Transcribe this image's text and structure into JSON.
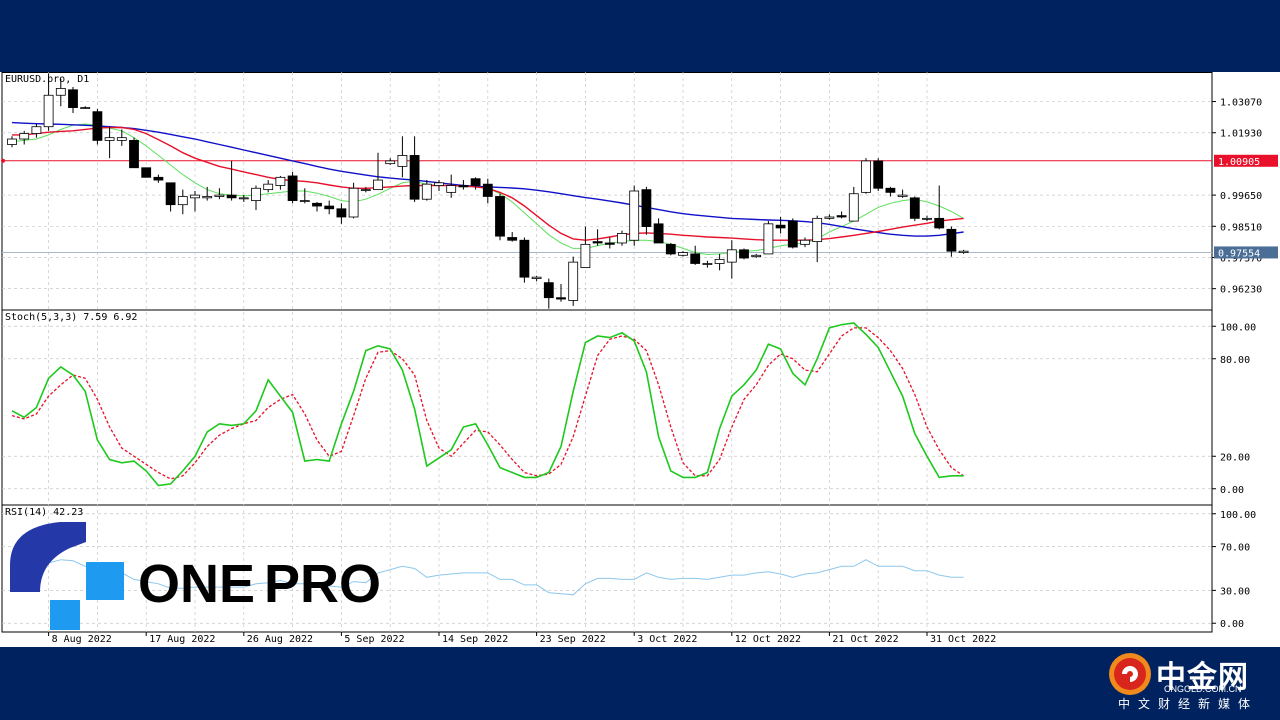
{
  "chart_data": {
    "type": "candlestick",
    "symbol_label": "EURUSD.pro, D1",
    "price_ticks": [
      "1.03070",
      "1.01930",
      "0.99650",
      "0.98510",
      "0.97370",
      "0.96230"
    ],
    "price_range": [
      0.9545,
      1.0415
    ],
    "markers": {
      "red_line_label": "1.00905",
      "red_line_value": 1.00905,
      "current_label": "0.97554",
      "current_value": 0.97554,
      "red_color": "#e8102a",
      "current_color": "#4a6e96"
    },
    "x_labels": [
      {
        "i": 3,
        "text": "8 Aug 2022"
      },
      {
        "i": 11,
        "text": "17 Aug 2022"
      },
      {
        "i": 19,
        "text": "26 Aug 2022"
      },
      {
        "i": 27,
        "text": "5 Sep 2022"
      },
      {
        "i": 35,
        "text": "14 Sep 2022"
      },
      {
        "i": 43,
        "text": "23 Sep 2022"
      },
      {
        "i": 51,
        "text": "3 Oct 2022"
      },
      {
        "i": 59,
        "text": "12 Oct 2022"
      },
      {
        "i": 67,
        "text": "21 Oct 2022"
      },
      {
        "i": 75,
        "text": "31 Oct 2022"
      }
    ],
    "candles": [
      [
        1.015,
        1.018,
        1.014,
        1.017
      ],
      [
        1.017,
        1.02,
        1.015,
        1.019
      ],
      [
        1.019,
        1.0225,
        1.0175,
        1.0215
      ],
      [
        1.0215,
        1.041,
        1.02,
        1.033
      ],
      [
        1.033,
        1.039,
        1.029,
        1.0355
      ],
      [
        1.035,
        1.036,
        1.0265,
        1.0285
      ],
      [
        1.0285,
        1.029,
        1.028,
        1.0285
      ],
      [
        1.027,
        1.028,
        1.015,
        1.0165
      ],
      [
        1.0165,
        1.0215,
        1.01,
        1.0175
      ],
      [
        1.0165,
        1.0205,
        1.0145,
        1.0175
      ],
      [
        1.0165,
        1.0175,
        1.0065,
        1.0065
      ],
      [
        1.0065,
        1.0065,
        1.003,
        1.003
      ],
      [
        1.003,
        1.004,
        1.001,
        1.002
      ],
      [
        1.001,
        1.001,
        0.9905,
        0.993
      ],
      [
        0.993,
        0.9985,
        0.9895,
        0.996
      ],
      [
        0.9955,
        0.998,
        0.9905,
        0.9965
      ],
      [
        0.9955,
        0.9995,
        0.9945,
        0.996
      ],
      [
        0.996,
        0.999,
        0.995,
        0.9965
      ],
      [
        0.9965,
        1.009,
        0.9945,
        0.9955
      ],
      [
        0.9955,
        0.9965,
        0.994,
        0.9955
      ],
      [
        0.9945,
        1.0,
        0.991,
        0.999
      ],
      [
        0.9985,
        1.002,
        0.9975,
        1.0005
      ],
      [
        1.0,
        1.0035,
        0.9985,
        1.003
      ],
      [
        1.0035,
        1.005,
        0.9935,
        0.9945
      ],
      [
        0.9945,
        0.999,
        0.9935,
        0.9945
      ],
      [
        0.9935,
        0.994,
        0.9905,
        0.9925
      ],
      [
        0.9925,
        0.9945,
        0.9895,
        0.9915
      ],
      [
        0.9915,
        0.9935,
        0.986,
        0.9885
      ],
      [
        0.9885,
        1.001,
        0.988,
        0.999
      ],
      [
        0.9985,
        0.9995,
        0.9975,
        0.9985
      ],
      [
        0.9985,
        1.012,
        0.9985,
        1.002
      ],
      [
        1.008,
        1.01,
        1.0075,
        1.009
      ],
      [
        1.007,
        1.018,
        1.003,
        1.011
      ],
      [
        1.011,
        1.018,
        0.994,
        0.995
      ],
      [
        0.995,
        1.002,
        0.9945,
        1.0005
      ],
      [
        1.0,
        1.002,
        0.998,
        1.001
      ],
      [
        0.9975,
        1.004,
        0.9955,
        1.0
      ],
      [
        1.0,
        1.002,
        0.9985,
        0.9995
      ],
      [
        1.0025,
        1.003,
        0.9985,
        1.0
      ],
      [
        1.0005,
        1.0025,
        0.9935,
        0.996
      ],
      [
        0.996,
        0.997,
        0.98,
        0.9815
      ],
      [
        0.981,
        0.983,
        0.9795,
        0.98
      ],
      [
        0.98,
        0.981,
        0.9645,
        0.9665
      ],
      [
        0.966,
        0.967,
        0.965,
        0.9665
      ],
      [
        0.9645,
        0.966,
        0.955,
        0.959
      ],
      [
        0.959,
        0.964,
        0.9575,
        0.9585
      ],
      [
        0.958,
        0.974,
        0.956,
        0.972
      ],
      [
        0.97,
        0.985,
        0.97,
        0.9785
      ],
      [
        0.9795,
        0.984,
        0.978,
        0.979
      ],
      [
        0.979,
        0.981,
        0.977,
        0.9785
      ],
      [
        0.979,
        0.9835,
        0.978,
        0.9825
      ],
      [
        0.98,
        1.0,
        0.978,
        0.998
      ],
      [
        0.9985,
        0.9995,
        0.982,
        0.985
      ],
      [
        0.986,
        0.988,
        0.979,
        0.979
      ],
      [
        0.9785,
        0.979,
        0.9745,
        0.975
      ],
      [
        0.9745,
        0.976,
        0.974,
        0.9755
      ],
      [
        0.975,
        0.978,
        0.971,
        0.9715
      ],
      [
        0.9715,
        0.9725,
        0.97,
        0.9715
      ],
      [
        0.9715,
        0.975,
        0.969,
        0.973
      ],
      [
        0.972,
        0.98,
        0.966,
        0.9765
      ],
      [
        0.9765,
        0.977,
        0.973,
        0.9735
      ],
      [
        0.974,
        0.975,
        0.9735,
        0.9745
      ],
      [
        0.975,
        0.987,
        0.975,
        0.986
      ],
      [
        0.9855,
        0.9885,
        0.9825,
        0.9845
      ],
      [
        0.987,
        0.988,
        0.977,
        0.9775
      ],
      [
        0.9785,
        0.981,
        0.9775,
        0.98
      ],
      [
        0.9795,
        0.989,
        0.972,
        0.988
      ],
      [
        0.988,
        0.9895,
        0.9875,
        0.9885
      ],
      [
        0.989,
        0.9905,
        0.988,
        0.9885
      ],
      [
        0.987,
        0.9995,
        0.987,
        0.997
      ],
      [
        0.9975,
        1.01,
        0.997,
        1.009
      ],
      [
        1.009,
        1.01,
        0.998,
        0.999
      ],
      [
        0.999,
        0.9995,
        0.996,
        0.9975
      ],
      [
        0.996,
        0.9985,
        0.9955,
        0.9965
      ],
      [
        0.9955,
        0.996,
        0.987,
        0.988
      ],
      [
        0.988,
        0.989,
        0.987,
        0.988
      ],
      [
        0.988,
        1.0,
        0.984,
        0.9845
      ],
      [
        0.984,
        0.985,
        0.974,
        0.976
      ],
      [
        0.9755,
        0.9765,
        0.975,
        0.976
      ]
    ],
    "ma_fast": [
      1.016,
      1.0165,
      1.017,
      1.0185,
      1.0205,
      1.022,
      1.0225,
      1.022,
      1.021,
      1.02,
      1.0175,
      1.0145,
      1.011,
      1.0075,
      1.004,
      1.001,
      0.9985,
      0.997,
      0.9965,
      0.9962,
      0.9965,
      0.997,
      0.9975,
      0.998,
      0.998,
      0.9972,
      0.996,
      0.9945,
      0.994,
      0.995,
      0.9968,
      0.999,
      1.001,
      1.0015,
      1.0005,
      1.0,
      1.0,
      0.9998,
      0.9996,
      0.999,
      0.997,
      0.994,
      0.99,
      0.986,
      0.982,
      0.979,
      0.977,
      0.977,
      0.978,
      0.979,
      0.9795,
      0.98,
      0.98,
      0.9795,
      0.9785,
      0.977,
      0.9755,
      0.9748,
      0.975,
      0.9755,
      0.976,
      0.9762,
      0.977,
      0.978,
      0.9785,
      0.979,
      0.9805,
      0.983,
      0.985,
      0.987,
      0.9895,
      0.992,
      0.9935,
      0.9945,
      0.995,
      0.994,
      0.9925,
      0.9905,
      0.988
    ],
    "ma_mid": [
      1.0185,
      1.0185,
      1.019,
      1.0195,
      1.0198,
      1.02,
      1.0205,
      1.021,
      1.0212,
      1.0212,
      1.0205,
      1.019,
      1.0168,
      1.0145,
      1.012,
      1.01,
      1.0085,
      1.007,
      1.006,
      1.005,
      1.004,
      1.003,
      1.0022,
      1.0018,
      1.0015,
      1.001,
      1.0002,
      0.9995,
      0.999,
      0.999,
      0.9992,
      0.9995,
      0.9998,
      1.0,
      1.0,
      1.0,
      1.0,
      0.9998,
      0.9995,
      0.999,
      0.9975,
      0.9955,
      0.9925,
      0.989,
      0.9855,
      0.9825,
      0.9805,
      0.98,
      0.9805,
      0.9812,
      0.982,
      0.9825,
      0.9827,
      0.9825,
      0.9822,
      0.9818,
      0.9815,
      0.9812,
      0.981,
      0.9808,
      0.9805,
      0.9802,
      0.98,
      0.98,
      0.98,
      0.98,
      0.9802,
      0.9806,
      0.9812,
      0.9818,
      0.9825,
      0.9832,
      0.984,
      0.9848,
      0.9855,
      0.9862,
      0.987,
      0.9875,
      0.988
    ],
    "ma_slow": [
      1.023,
      1.0228,
      1.0226,
      1.0225,
      1.0224,
      1.0222,
      1.022,
      1.0218,
      1.0215,
      1.0212,
      1.0208,
      1.0202,
      1.0195,
      1.0187,
      1.0178,
      1.017,
      1.016,
      1.015,
      1.014,
      1.013,
      1.012,
      1.011,
      1.01,
      1.009,
      1.008,
      1.007,
      1.006,
      1.0052,
      1.0045,
      1.0038,
      1.0032,
      1.0027,
      1.0023,
      1.002,
      1.0015,
      1.001,
      1.0005,
      1.0,
      0.9997,
      0.9995,
      0.9993,
      0.9991,
      0.9988,
      0.9983,
      0.9977,
      0.997,
      0.9963,
      0.9956,
      0.995,
      0.9943,
      0.9936,
      0.9928,
      0.992,
      0.9912,
      0.9904,
      0.9897,
      0.9892,
      0.9888,
      0.9884,
      0.988,
      0.9878,
      0.9876,
      0.9874,
      0.9873,
      0.9871,
      0.9868,
      0.9864,
      0.9858,
      0.985,
      0.9842,
      0.9835,
      0.9828,
      0.9822,
      0.9818,
      0.9815,
      0.9815,
      0.9818,
      0.9824,
      0.983
    ],
    "ma_colors": {
      "fast": "#5de05d",
      "mid": "#e8102a",
      "slow": "#1010c8"
    },
    "stoch": {
      "label": "Stoch(5,3,3) 7.59 6.92",
      "ticks": [
        "100.00",
        "80.00",
        "20.00",
        "0.00"
      ],
      "tick_values": [
        100,
        80,
        20,
        0
      ],
      "k": [
        48,
        44,
        50,
        68,
        75,
        70,
        60,
        30,
        18,
        16,
        17,
        11,
        2,
        3,
        11,
        20,
        35,
        40,
        39,
        40,
        48,
        67,
        57,
        47,
        17,
        18,
        17,
        40,
        60,
        85,
        88,
        86,
        73,
        49,
        14,
        19,
        24,
        38,
        40,
        27,
        13,
        10,
        7,
        7,
        10,
        26,
        60,
        90,
        94,
        93,
        96,
        91,
        72,
        32,
        11,
        7,
        7,
        10,
        37,
        57,
        64,
        73,
        89,
        86,
        71,
        64,
        80,
        99,
        101,
        102,
        95,
        87,
        72,
        57,
        34,
        20,
        7,
        8,
        8
      ],
      "d": [
        45,
        43,
        46,
        57,
        64,
        70,
        68,
        55,
        38,
        25,
        20,
        15,
        10,
        6,
        8,
        16,
        26,
        33,
        37,
        40,
        42,
        50,
        55,
        58,
        46,
        30,
        20,
        23,
        45,
        68,
        84,
        85,
        80,
        70,
        42,
        25,
        20,
        28,
        36,
        35,
        27,
        18,
        10,
        8,
        9,
        15,
        32,
        57,
        82,
        92,
        94,
        92,
        85,
        64,
        38,
        16,
        8,
        8,
        18,
        38,
        55,
        64,
        76,
        83,
        80,
        73,
        72,
        83,
        94,
        99,
        99,
        93,
        85,
        74,
        58,
        38,
        24,
        13,
        8
      ],
      "range": [
        -10,
        110
      ]
    },
    "rsi": {
      "label": "RSI(14) 42.23",
      "ticks": [
        "100.00",
        "70.00",
        "30.00",
        "0.00"
      ],
      "tick_values": [
        100,
        70,
        30,
        0
      ],
      "values": [
        50,
        52,
        52,
        55,
        58,
        57,
        52,
        46,
        46,
        46,
        40,
        38,
        36,
        32,
        32,
        33,
        33,
        33,
        33,
        33,
        36,
        37,
        39,
        36,
        36,
        35,
        34,
        33,
        38,
        37,
        46,
        49,
        52,
        50,
        42,
        44,
        45,
        46,
        46,
        46,
        40,
        40,
        35,
        35,
        28,
        27,
        26,
        36,
        41,
        41,
        40,
        40,
        46,
        42,
        40,
        41,
        41,
        40,
        42,
        44,
        44,
        46,
        47,
        45,
        42,
        45,
        46,
        49,
        52,
        52,
        58,
        52,
        52,
        52,
        48,
        48,
        44,
        42,
        42
      ],
      "color": "#8ec7ec",
      "range": [
        -8,
        108
      ]
    },
    "colors": {
      "k_line": "#1ec81e",
      "d_line": "#e8102a",
      "grid": "#c8c8c8"
    }
  },
  "logos": {
    "onepro": {
      "one": "ONE",
      "pro": "PRO",
      "one_color": "#3a3a3a",
      "pro_color": "#2438a8",
      "accent": "#2438a8",
      "accent2": "#1e9bf0"
    },
    "cngold": {
      "name": "中金网",
      "site": "CNGOLD.COM.CN",
      "slogan": "中文财经新媒体"
    }
  }
}
